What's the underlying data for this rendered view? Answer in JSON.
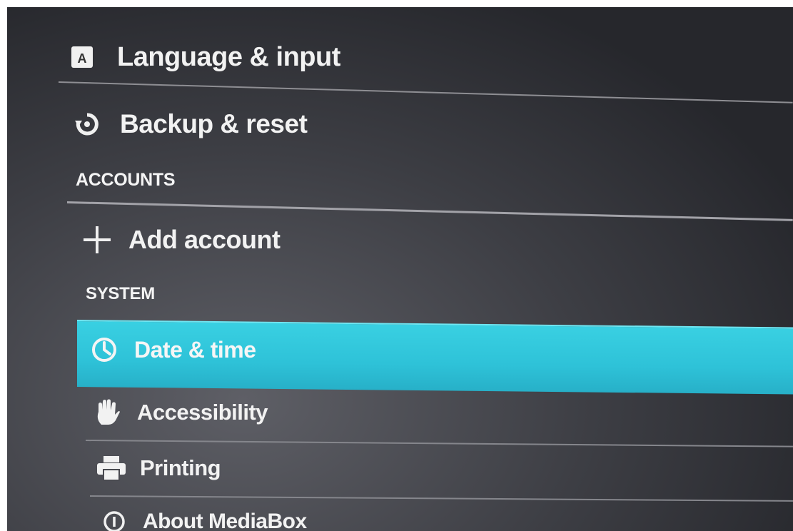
{
  "settings": {
    "items": {
      "language_input": {
        "label": "Language & input",
        "icon": "language-icon"
      },
      "backup_reset": {
        "label": "Backup & reset",
        "icon": "backup-icon"
      },
      "add_account": {
        "label": "Add account",
        "icon": "plus-icon"
      },
      "date_time": {
        "label": "Date & time",
        "icon": "clock-icon",
        "selected": true
      },
      "accessibility": {
        "label": "Accessibility",
        "icon": "hand-icon"
      },
      "printing": {
        "label": "Printing",
        "icon": "printer-icon"
      },
      "about": {
        "label": "About MediaBox",
        "icon": "info-icon"
      }
    },
    "sections": {
      "accounts": "ACCOUNTS",
      "system": "SYSTEM"
    }
  },
  "colors": {
    "highlight": "#2ec2d8",
    "text": "#f2f2f2",
    "divider": "#8e8e93",
    "background": "#3d3e44"
  }
}
